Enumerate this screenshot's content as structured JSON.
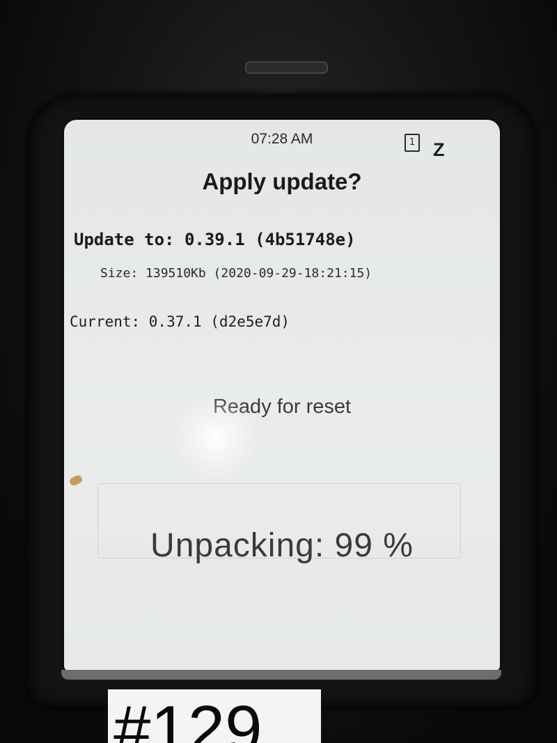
{
  "status_bar": {
    "time": "07:28 AM",
    "sim_slot": "1",
    "network": "Z"
  },
  "dialog": {
    "title": "Apply update?",
    "update_to": "Update to: 0.39.1 (4b51748e)",
    "size": "Size: 139510Kb (2020-09-29-18:21:15)",
    "current": "Current: 0.37.1 (d2e5e7d)",
    "reset_status": "Ready for reset",
    "progress_text": "Unpacking: 99 %",
    "progress_percent": 99
  },
  "label": {
    "text": "#129"
  }
}
